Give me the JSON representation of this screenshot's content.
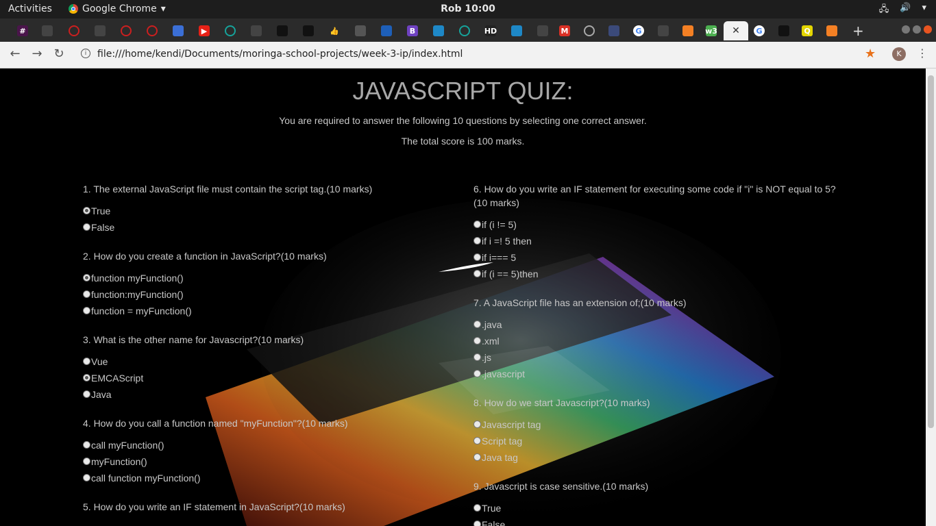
{
  "system": {
    "activities": "Activities",
    "app_name": "Google Chrome",
    "clock": "Rob 10:00"
  },
  "tabs": [
    {
      "icon": "slack-icon",
      "glyph": "#",
      "color": "#4a154b"
    },
    {
      "icon": "page-icon",
      "glyph": "",
      "color": "#444"
    },
    {
      "icon": "opera-icon",
      "glyph": "",
      "color": "#cc1f1f"
    },
    {
      "icon": "page-icon",
      "glyph": "",
      "color": "#444"
    },
    {
      "icon": "opera-icon",
      "glyph": "",
      "color": "#cc1f1f"
    },
    {
      "icon": "opera-icon",
      "glyph": "",
      "color": "#cc1f1f"
    },
    {
      "icon": "cloud-icon",
      "glyph": "",
      "color": "#3b6fd6"
    },
    {
      "icon": "youtube-icon",
      "glyph": "▶",
      "color": "#e62117"
    },
    {
      "icon": "circle-icon",
      "glyph": "",
      "color": "#16a39b"
    },
    {
      "icon": "page-icon",
      "glyph": "",
      "color": "#444"
    },
    {
      "icon": "github-icon",
      "glyph": "",
      "color": "#111"
    },
    {
      "icon": "github-icon",
      "glyph": "",
      "color": "#111"
    },
    {
      "icon": "thumbs-up-icon",
      "glyph": "👍",
      "color": "#2b2b2b"
    },
    {
      "icon": "africa-icon",
      "glyph": "",
      "color": "#555"
    },
    {
      "icon": "edge-icon",
      "glyph": "",
      "color": "#1e5fb8"
    },
    {
      "icon": "bootstrap-icon",
      "glyph": "B",
      "color": "#6f42c1"
    },
    {
      "icon": "bird-icon",
      "glyph": "",
      "color": "#1e88c7"
    },
    {
      "icon": "circle-icon",
      "glyph": "",
      "color": "#16a39b"
    },
    {
      "icon": "hd-icon",
      "glyph": "HD",
      "color": "#222"
    },
    {
      "icon": "bird-icon",
      "glyph": "",
      "color": "#1e88c7"
    },
    {
      "icon": "page-icon",
      "glyph": "",
      "color": "#444"
    },
    {
      "icon": "gmail-icon",
      "glyph": "M",
      "color": "#d93025"
    },
    {
      "icon": "loading-icon",
      "glyph": "",
      "color": "#2b2b2b"
    },
    {
      "icon": "globe-icon",
      "glyph": "",
      "color": "#3b4a7a"
    },
    {
      "icon": "google-icon",
      "glyph": "G",
      "color": "#ffffff"
    },
    {
      "icon": "page-icon",
      "glyph": "",
      "color": "#444"
    },
    {
      "icon": "stackoverflow-icon",
      "glyph": "",
      "color": "#f48024"
    },
    {
      "icon": "w3-icon",
      "glyph": "w3",
      "color": "#4caf50"
    },
    {
      "icon": "close-icon",
      "glyph": "✕",
      "color": "#f2f2f2"
    },
    {
      "icon": "google-icon",
      "glyph": "G",
      "color": "#ffffff"
    },
    {
      "icon": "github-icon",
      "glyph": "",
      "color": "#111"
    },
    {
      "icon": "q-icon",
      "glyph": "Q",
      "color": "#e3d500"
    },
    {
      "icon": "stackoverflow-icon",
      "glyph": "",
      "color": "#f48024"
    }
  ],
  "toolbar": {
    "url": "file:///home/kendi/Documents/moringa-school-projects/week-3-ip/index.html",
    "avatar_letter": "K"
  },
  "page": {
    "title": "JAVASCRIPT QUIZ:",
    "instructions": "You are required to answer the following 10 questions by selecting one correct answer.",
    "total": "The total score is 100 marks."
  },
  "questions_left": [
    {
      "text": "1. The external JavaScript file must contain the script tag.(10 marks)",
      "options": [
        {
          "label": "True",
          "checked": true
        },
        {
          "label": "False",
          "checked": false
        }
      ]
    },
    {
      "text": "2. How do you create a function in JavaScript?(10 marks)",
      "options": [
        {
          "label": "function myFunction()",
          "checked": true
        },
        {
          "label": "function:myFunction()",
          "checked": false
        },
        {
          "label": "function = myFunction()",
          "checked": false
        }
      ]
    },
    {
      "text": "3. What is the other name for Javascript?(10 marks)",
      "options": [
        {
          "label": "Vue",
          "checked": false
        },
        {
          "label": "EMCAScript",
          "checked": true
        },
        {
          "label": "Java",
          "checked": false
        }
      ]
    },
    {
      "text": "4. How do you call a function named \"myFunction\"?(10 marks)",
      "options": [
        {
          "label": "call myFunction()",
          "checked": false
        },
        {
          "label": "myFunction()",
          "checked": false
        },
        {
          "label": "call function myFunction()",
          "checked": false
        }
      ]
    },
    {
      "text": "5. How do you write an IF statement in JavaScript?(10 marks)",
      "options": []
    }
  ],
  "questions_right": [
    {
      "text": "6. How do you write an IF statement for executing some code if \"i\" is NOT equal to 5?(10 marks)",
      "options": [
        {
          "label": "if (i != 5)",
          "checked": false
        },
        {
          "label": "if i =! 5 then",
          "checked": false
        },
        {
          "label": "if i=== 5",
          "checked": false
        },
        {
          "label": "if (i == 5)then",
          "checked": false
        }
      ]
    },
    {
      "text": "7. A JavaScript file has an extension of;(10 marks)",
      "options": [
        {
          "label": ".java",
          "checked": false
        },
        {
          "label": ".xml",
          "checked": false
        },
        {
          "label": ".js",
          "checked": false
        },
        {
          "label": ".javascript",
          "checked": false
        }
      ]
    },
    {
      "text": "8. How do we start Javascript?(10 marks)",
      "options": [
        {
          "label": "Javascript tag",
          "checked": false
        },
        {
          "label": "Script tag",
          "checked": false
        },
        {
          "label": "Java tag",
          "checked": false
        }
      ]
    },
    {
      "text": "9. Javascript is case sensitive.(10 marks)",
      "options": [
        {
          "label": "True",
          "checked": false
        },
        {
          "label": "False",
          "checked": false
        }
      ]
    }
  ]
}
